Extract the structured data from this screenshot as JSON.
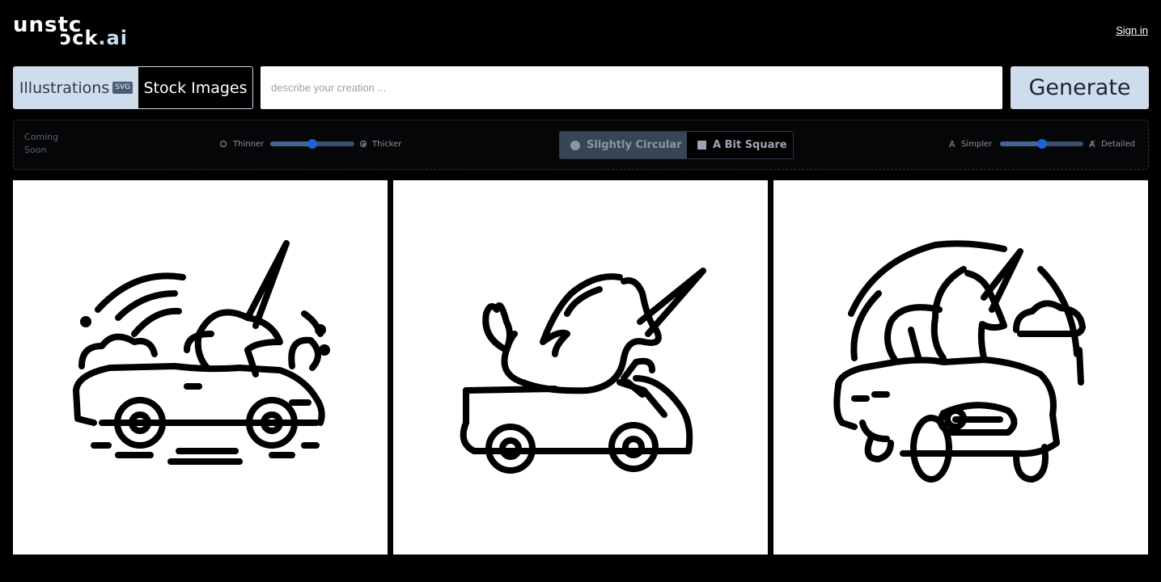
{
  "logo": {
    "line1": "unstc",
    "line2_a": "ɔck",
    "line2_b": ".ai"
  },
  "header": {
    "signin_label": "Sign in"
  },
  "toolbar": {
    "tabs": [
      {
        "label": "Illustrations",
        "badge": "SVG"
      },
      {
        "label": "Stock Images"
      }
    ],
    "prompt_placeholder": "describe your creation ...",
    "prompt_value": "",
    "generate_label": "Generate"
  },
  "options": {
    "coming_soon": [
      "Coming",
      "Soon"
    ],
    "stroke": {
      "min_label": "Thinner",
      "max_label": "Thicker",
      "value": 0.5
    },
    "shape": {
      "options": [
        "Slightly Circular",
        "A Bit Square"
      ],
      "selected": "Slightly Circular"
    },
    "detail": {
      "min_label": "Simpler",
      "max_label": "Detailed",
      "value": 0.5
    }
  },
  "results": [
    {
      "icon": "unicorn-convertible-car-illustration"
    },
    {
      "icon": "unicorn-riding-car-illustration"
    },
    {
      "icon": "unicorn-classic-car-illustration"
    }
  ]
}
